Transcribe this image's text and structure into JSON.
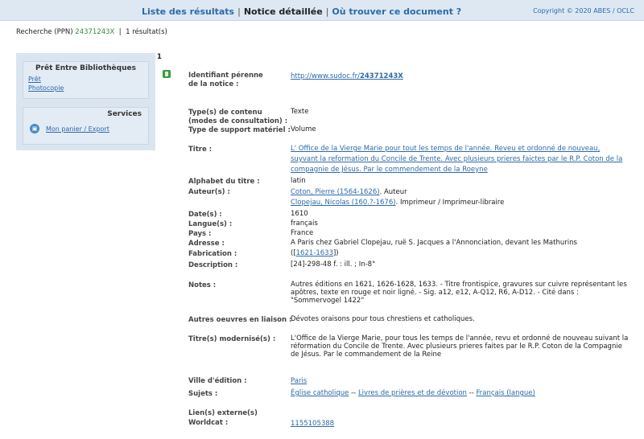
{
  "nav": {
    "results": "Liste des résultats",
    "separator1": "|",
    "detail": "Notice détaillée",
    "separator2": "|",
    "where": "Où trouver ce document ?",
    "copyright": "Copyright © 2020 ABES / OCLC"
  },
  "search": {
    "prefix": "Recherche (PPN)",
    "ppn": "24371243X",
    "separator": "|",
    "count": "1 résultat(s)"
  },
  "sidebar": {
    "peb_title": "Prêt Entre Bibliothèques",
    "pret": "Prêt",
    "photocopie": "Photocopie",
    "services_title": "Services",
    "basket": "Mon panier / Export"
  },
  "record": {
    "number": "1",
    "identifier": {
      "label": "Identifiant pérenne de la notice :",
      "url_prefix": "http://www.sudoc.fr/",
      "url_id": "24371243X"
    },
    "content_type": {
      "label": "Type(s) de contenu (modes de consultation) :",
      "value": "Texte"
    },
    "support": {
      "label": "Type de support matériel :",
      "value": "Volume"
    },
    "title": {
      "label": "Titre :",
      "value": "L' Office de la Vierge Marie pour tout les temps de l'année. Reveu et ordonné de nouveau, suyvant la reformation du Concile de Trente. Avec plusieurs prieres faictes par le R.P. Coton de la compagnie de Jésus. Par le commendement de la Roeyne"
    },
    "alphabet": {
      "label": "Alphabet du titre :",
      "value": "latin"
    },
    "authors": {
      "label": "Auteur(s) :",
      "a1_name": "Coton, Pierre (1564-1626)",
      "a1_role": ". Auteur",
      "a2_name": "Clopejau, Nicolas (160.?-1676)",
      "a2_role": ". Imprimeur / Imprimeur-libraire"
    },
    "date": {
      "label": "Date(s) :",
      "value": "1610"
    },
    "language": {
      "label": "Langue(s) :",
      "value": "français"
    },
    "country": {
      "label": "Pays :",
      "value": "France"
    },
    "address": {
      "label": "Adresse :",
      "value": "A Paris chez Gabriel Clopejau, ruë S. Jacques a l'Annonciation, devant les Mathurins"
    },
    "fabrication": {
      "label": "Fabrication :",
      "open": "([",
      "link": "1621-1633",
      "close": "])"
    },
    "description": {
      "label": "Description :",
      "value": "[24]-298-48 f. : ill. ; In-8°"
    },
    "notes": {
      "label": "Notes :",
      "value": "Autres éditions en 1621, 1626-1628, 1633. - Titre frontispice, gravures sur cuivre représentant les apôtres, texte en rouge et noir ligné. - Sig. a12, e12, A-Q12, R6, A-D12. - Cité dans : \"Sommervogel 1422\""
    },
    "other_works": {
      "label": "Autres oeuvres en liaison :",
      "value": "Dévotes oraisons pour tous chrestiens et catholiques."
    },
    "modern_title": {
      "label": "Titre(s) modernisé(s) :",
      "value": "L'Office de la Vierge Marie, pour tous les temps de l'année, revu et ordonné de nouveau suivant la réformation du Concile de Trente. Avec plusieurs prieres faites par le R.P. Coton de la Compagnie de Jésus. Par le commandement de la Reine"
    },
    "city": {
      "label": "Ville d'édition :",
      "value": "Paris"
    },
    "subjects": {
      "label": "Sujets :",
      "s1": "Église catholique",
      "sep1": " -- ",
      "s2": "Livres de prières et de dévotion",
      "sep2": " -- ",
      "s3": "Français (langue)"
    },
    "external": {
      "label": "Lien(s) externe(s)"
    },
    "worldcat": {
      "label": "Worldcat :",
      "value": "1155105388"
    }
  }
}
